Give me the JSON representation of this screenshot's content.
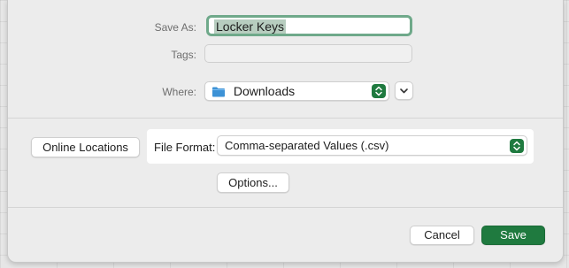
{
  "save_dialog": {
    "save_as_label": "Save As:",
    "save_as_value": "Locker Keys",
    "tags_label": "Tags:",
    "where_label": "Where:",
    "where_value": "Downloads",
    "online_locations_label": "Online Locations",
    "file_format_label": "File Format:",
    "file_format_value": "Comma-separated Values (.csv)",
    "options_label": "Options...",
    "cancel_label": "Cancel",
    "save_label": "Save"
  },
  "colors": {
    "accent": "#1f7a3f",
    "focus_ring": "#6fa98a",
    "folder": "#3d92d6"
  },
  "icons": {
    "folder": "folder-icon",
    "stepper": "updown-chevron-icon",
    "expand": "chevron-down-icon"
  }
}
